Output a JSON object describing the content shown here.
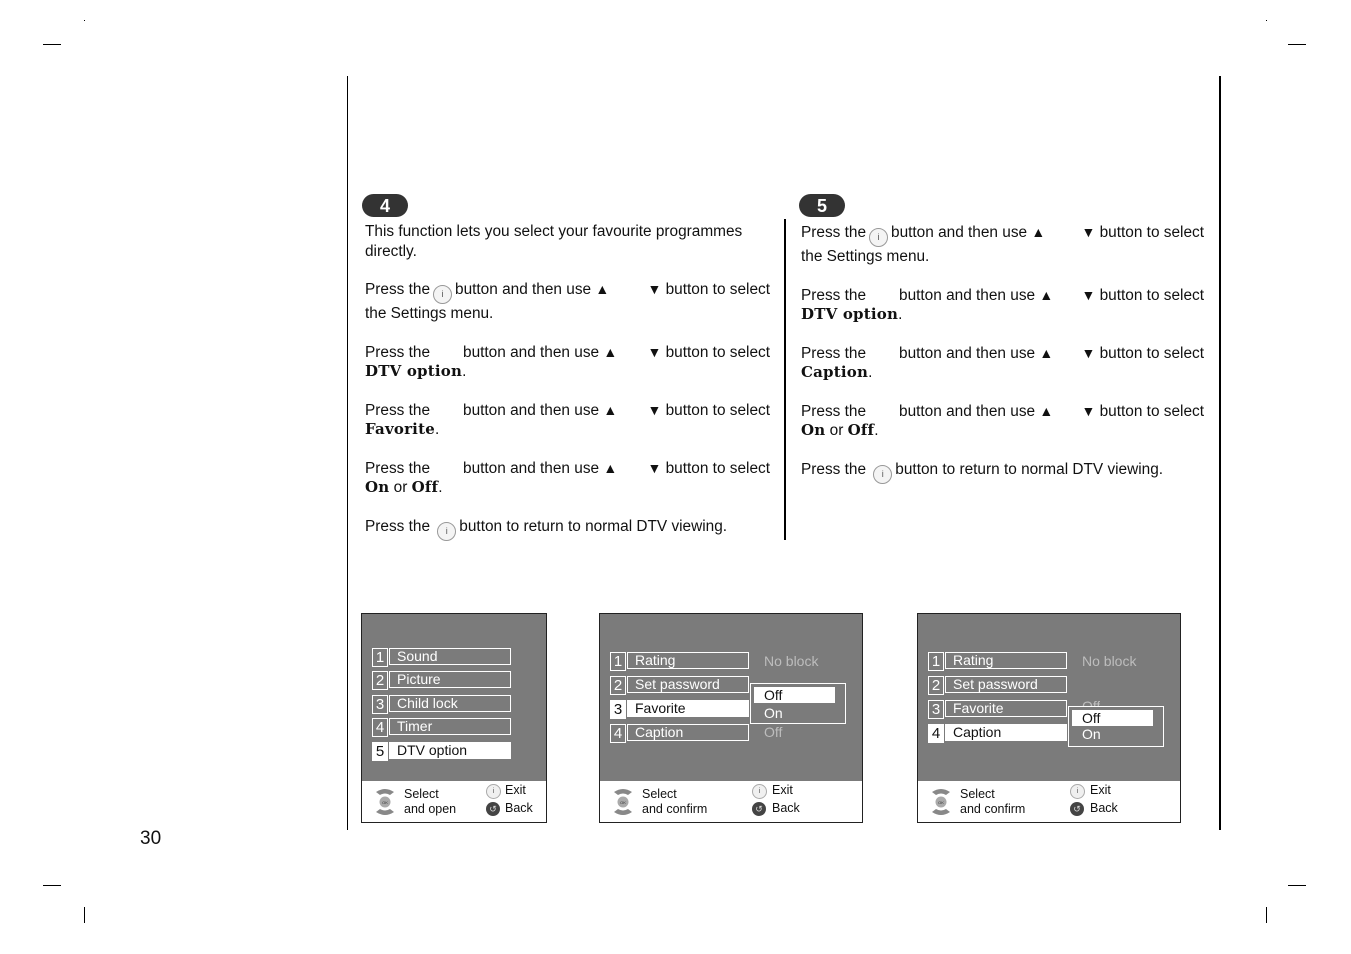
{
  "page_number": "30",
  "steps": [
    {
      "badge": "4",
      "intro": [
        "This function lets you select your favourite programmes",
        "directly."
      ],
      "instructions": [
        {
          "pre": "Press the",
          "mid": "button and then use",
          "post": "button to select",
          "target": "the Settings menu.",
          "button_icon": "info-button"
        },
        {
          "pre": "Press the",
          "mid": "button and then use",
          "post": "button to select",
          "target": "DTV option"
        },
        {
          "pre": "Press the",
          "mid": "button and then use",
          "post": "button to select",
          "target": "Favorite"
        },
        {
          "pre": "Press the",
          "mid": "button and then use",
          "post": "button to select",
          "target_a": "On",
          "or": "or",
          "target_b": "Off"
        }
      ],
      "final": {
        "pre": "Press the",
        "post": "button to return to normal DTV viewing."
      }
    },
    {
      "badge": "5",
      "instructions": [
        {
          "pre": "Press the",
          "mid": "button and then use",
          "post": "button to select",
          "target": "the Settings menu.",
          "button_icon": "info-button"
        },
        {
          "pre": "Press the",
          "mid": "button and then use",
          "post": "button to select",
          "target": "DTV option"
        },
        {
          "pre": "Press the",
          "mid": "button and then use",
          "post": "button to select",
          "target": "Caption"
        },
        {
          "pre": "Press the",
          "mid": "button and then use",
          "post": "button to select",
          "target_a": "On",
          "or": "or",
          "target_b": "Off"
        }
      ],
      "final": {
        "pre": "Press the",
        "post": "button to return to normal DTV viewing."
      }
    }
  ],
  "icons": {
    "up": "▲",
    "down": "▼",
    "info": "i",
    "back": "↺",
    "period": "."
  },
  "menus": [
    {
      "items": [
        {
          "num": "1",
          "label": "Sound"
        },
        {
          "num": "2",
          "label": "Picture"
        },
        {
          "num": "3",
          "label": "Child lock"
        },
        {
          "num": "4",
          "label": "Timer"
        },
        {
          "num": "5",
          "label": "DTV option",
          "selected": true
        }
      ],
      "footer": {
        "select": "Select",
        "select2": "and open",
        "exit": "Exit",
        "back": "Back"
      }
    },
    {
      "items": [
        {
          "num": "1",
          "label": "Rating",
          "value": "No block"
        },
        {
          "num": "2",
          "label": "Set password"
        },
        {
          "num": "3",
          "label": "Favorite",
          "selected": true
        },
        {
          "num": "4",
          "label": "Caption",
          "value": "Off"
        }
      ],
      "popup": [
        {
          "label": "Off",
          "selected": true
        },
        {
          "label": "On"
        }
      ],
      "footer": {
        "select": "Select",
        "select2": "and confirm",
        "exit": "Exit",
        "back": "Back"
      }
    },
    {
      "items": [
        {
          "num": "1",
          "label": "Rating",
          "value": "No block"
        },
        {
          "num": "2",
          "label": "Set password"
        },
        {
          "num": "3",
          "label": "Favorite",
          "value": "Off"
        },
        {
          "num": "4",
          "label": "Caption",
          "selected": true
        }
      ],
      "popup": [
        {
          "label": "Off",
          "selected": true
        },
        {
          "label": "On"
        }
      ],
      "footer": {
        "select": "Select",
        "select2": "and confirm",
        "exit": "Exit",
        "back": "Back"
      }
    }
  ]
}
